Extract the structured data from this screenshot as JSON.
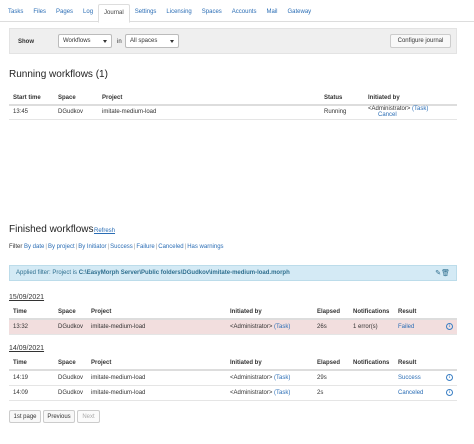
{
  "tabs": [
    "Tasks",
    "Files",
    "Pages",
    "Log",
    "Journal",
    "Settings",
    "Licensing",
    "Spaces",
    "Accounts",
    "Mail",
    "Gateway"
  ],
  "active_tab": "Journal",
  "filterbar": {
    "show_label": "Show",
    "type_value": "Workflows",
    "in_label": "in",
    "space_value": "All spaces",
    "configure_label": "Configure journal"
  },
  "running": {
    "title": "Running workflows (1)",
    "headers": [
      "Start time",
      "Space",
      "Project",
      "Status",
      "Initiated by"
    ],
    "rows": [
      {
        "time": "13:45",
        "space": "DGudkov",
        "project": "imitate-medium-load",
        "status": "Running",
        "initiator": "<Administrator>",
        "task": "(Task)",
        "action": "Cancel"
      }
    ]
  },
  "finished": {
    "title": "Finished workflows",
    "refresh": "Refresh",
    "filter_prefix": "Filter",
    "filters": [
      "By date",
      "By project",
      "By Initiator",
      "Success",
      "Failure",
      "Canceled",
      "Has warnings"
    ],
    "applied_prefix": "Applied filter: Project is",
    "applied_value": "C:\\EasyMorph Server\\Public folders\\DGudkov\\imitate-medium-load.morph",
    "headers": [
      "Time",
      "Space",
      "Project",
      "Initiated by",
      "Elapsed",
      "Notifications",
      "Result"
    ],
    "groups": [
      {
        "date": "15/09/2021",
        "rows": [
          {
            "time": "13:32",
            "space": "DGudkov",
            "project": "imitate-medium-load",
            "initiator": "<Administrator>",
            "task": "(Task)",
            "elapsed": "26s",
            "notifications": "1 error(s)",
            "result": "Failed"
          }
        ]
      },
      {
        "date": "14/09/2021",
        "rows": [
          {
            "time": "14:19",
            "space": "DGudkov",
            "project": "imitate-medium-load",
            "initiator": "<Administrator>",
            "task": "(Task)",
            "elapsed": "29s",
            "notifications": "",
            "result": "Success"
          },
          {
            "time": "14:09",
            "space": "DGudkov",
            "project": "imitate-medium-load",
            "initiator": "<Administrator>",
            "task": "(Task)",
            "elapsed": "2s",
            "notifications": "",
            "result": "Canceled"
          }
        ]
      }
    ]
  },
  "pagination": {
    "first": "1st page",
    "previous": "Previous",
    "next": "Next"
  },
  "colors": {
    "link": "#2a6db5",
    "failed_row": "#f2dede",
    "applied_bg": "#d4eaf5"
  }
}
